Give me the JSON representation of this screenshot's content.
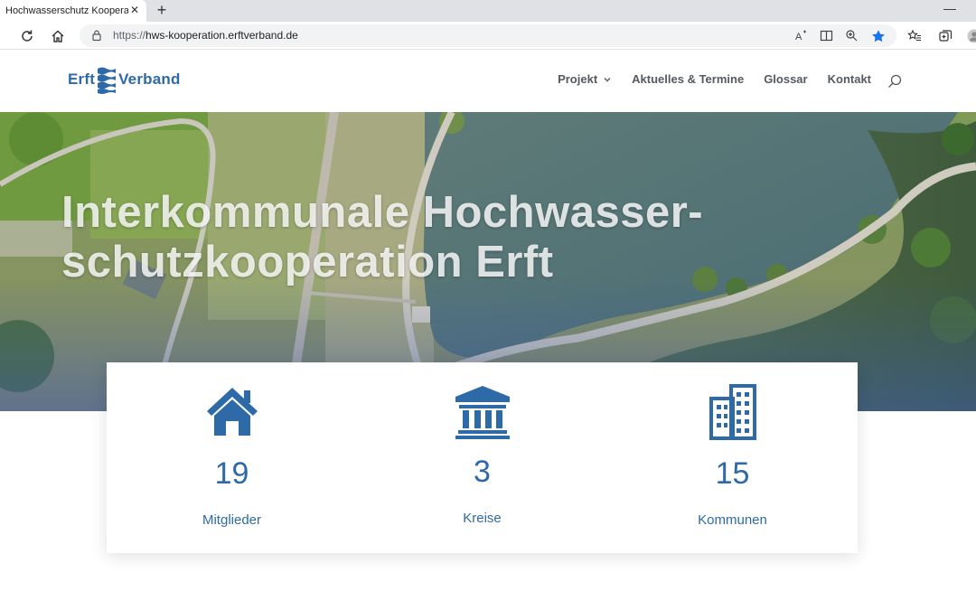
{
  "browser": {
    "tab_title": "Hochwasserschutz Kooperation E",
    "tab_close": "✕",
    "new_tab": "+",
    "minimize": "—",
    "url_protocol": "https://",
    "url_host": "hws-kooperation.erftverband.de"
  },
  "site": {
    "logo_left": "Erft",
    "logo_right": "Verband",
    "nav": [
      {
        "label": "Projekt",
        "has_dropdown": true
      },
      {
        "label": "Aktuelles & Termine"
      },
      {
        "label": "Glossar"
      },
      {
        "label": "Kontakt"
      }
    ]
  },
  "hero": {
    "title_line1": "Interkommunale Hochwasser-",
    "title_line2": "schutzkooperation Erft"
  },
  "stats": [
    {
      "icon": "house-icon",
      "value": "19",
      "label": "Mitglieder"
    },
    {
      "icon": "institution-icon",
      "value": "3",
      "label": "Kreise"
    },
    {
      "icon": "buildings-icon",
      "value": "15",
      "label": "Kommunen"
    }
  ],
  "colors": {
    "brand_blue": "#2e6aa8",
    "nav_text": "#555a5f",
    "star_blue": "#1a73e8"
  }
}
